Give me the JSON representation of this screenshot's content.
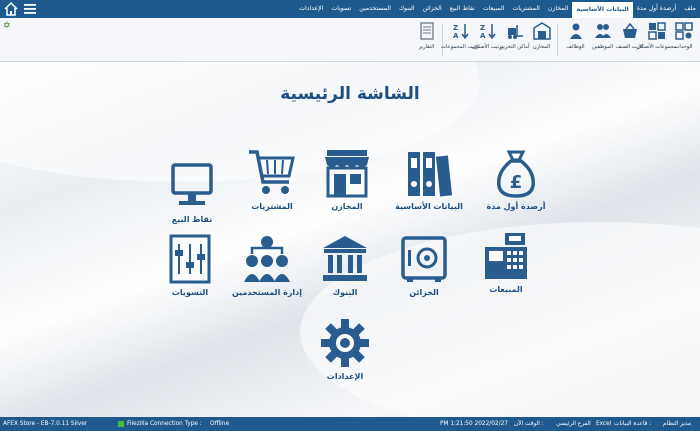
{
  "topbar": {
    "tabs": [
      "ملف",
      "أرصدة أول مدة",
      "البيانات الأساسية",
      "المخازن",
      "المشتريات",
      "المبيعات",
      "نقاط البيع",
      "الخزائن",
      "البنوك",
      "المستخدمين",
      "تسويات",
      "الإعدادات"
    ],
    "active_tab": "البيانات الأساسية"
  },
  "ribbon": {
    "items": [
      "الوحدات",
      "مجموعات الأصناف",
      "كارت الصنف",
      "الموظفين",
      "الوظائف",
      "المخازن",
      "أماكن التخزين",
      "ترتيب الأصناف",
      "ترتيب المجموعات",
      "التقارير"
    ]
  },
  "main": {
    "title": "الشاشة الرئيسية",
    "tiles": [
      {
        "label": "أرصدة أول مدة"
      },
      {
        "label": "البيانات الأساسية"
      },
      {
        "label": "المخازن"
      },
      {
        "label": "المشتريات"
      },
      {
        "label": "نقاط البيع"
      },
      {
        "label": "المبيعات"
      },
      {
        "label": "الخزائن"
      },
      {
        "label": "البنوك"
      },
      {
        "label": "إدارة المستخدمين"
      },
      {
        "label": "التسويات"
      },
      {
        "label": "الإعدادات"
      }
    ]
  },
  "status": {
    "app": "AFEX Store - EB-7.0.11  Silver",
    "db": "Filezilla",
    "conn_label": "Connection Type :",
    "conn_value": "Offline",
    "time": "PM 1:21:50  2022/02/27",
    "time_label": "الوقت الآن :",
    "branch": "الفرع الرئيسي",
    "excel": "Excel",
    "db_label": "قاعدة البيانات :",
    "user": "مدير النظام"
  },
  "colors": {
    "primary": "#1e5a8e",
    "icon": "#2a5d8f",
    "accent_green": "#3fbf3f"
  }
}
